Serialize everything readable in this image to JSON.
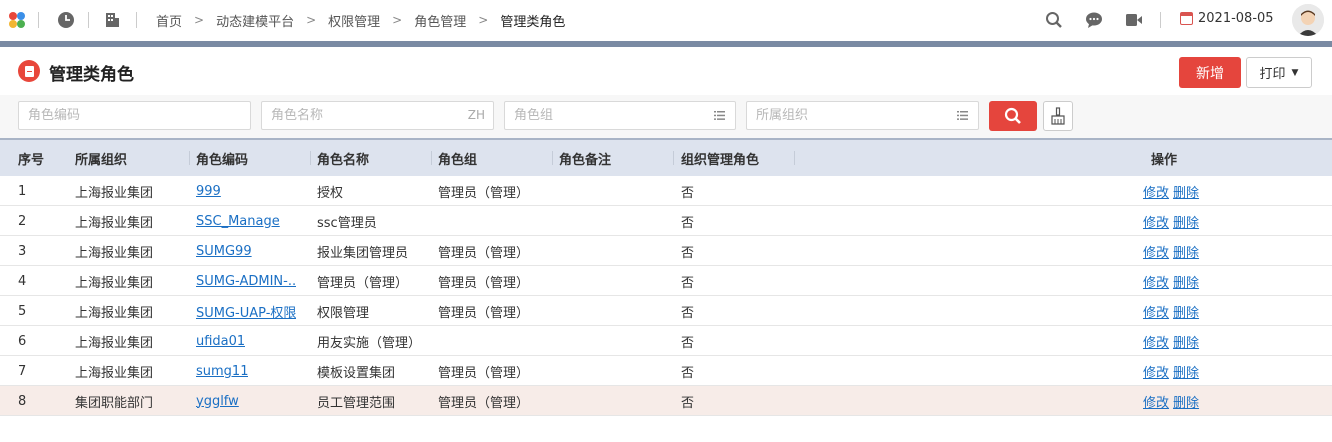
{
  "topbar": {
    "breadcrumbs": [
      "首页",
      "动态建模平台",
      "权限管理",
      "角色管理",
      "管理类角色"
    ],
    "date": "2021-08-05",
    "icons": [
      "app-logo-icon",
      "clock-icon",
      "building-icon",
      "search-icon",
      "chat-icon",
      "video-icon",
      "calendar-icon"
    ]
  },
  "page": {
    "title": "管理类角色",
    "new_label": "新增",
    "print_label": "打印"
  },
  "filters": {
    "code_placeholder": "角色编码",
    "name_placeholder": "角色名称",
    "name_suffix": "ZH",
    "group_placeholder": "角色组",
    "org_placeholder": "所属组织"
  },
  "table": {
    "headers": {
      "index": "序号",
      "org": "所属组织",
      "code": "角色编码",
      "name": "角色名称",
      "group": "角色组",
      "remark": "角色备注",
      "org_admin": "组织管理角色",
      "ops": "操作"
    },
    "edit_label": "修改",
    "delete_label": "删除",
    "rows": [
      {
        "index": "1",
        "org": "上海报业集团",
        "code": "999",
        "name": "授权",
        "group": "管理员（管理）",
        "remark": "",
        "org_admin": "否"
      },
      {
        "index": "2",
        "org": "上海报业集团",
        "code": "SSC_Manage",
        "name": "ssc管理员",
        "group": "",
        "remark": "",
        "org_admin": "否"
      },
      {
        "index": "3",
        "org": "上海报业集团",
        "code": "SUMG99",
        "name": "报业集团管理员",
        "group": "管理员（管理）",
        "remark": "",
        "org_admin": "否"
      },
      {
        "index": "4",
        "org": "上海报业集团",
        "code": "SUMG-ADMIN-...",
        "name": "管理员（管理）",
        "group": "管理员（管理）",
        "remark": "",
        "org_admin": "否"
      },
      {
        "index": "5",
        "org": "上海报业集团",
        "code": "SUMG-UAP-权限",
        "name": "权限管理",
        "group": "管理员（管理）",
        "remark": "",
        "org_admin": "否"
      },
      {
        "index": "6",
        "org": "上海报业集团",
        "code": "ufida01",
        "name": "用友实施（管理）",
        "group": "",
        "remark": "",
        "org_admin": "否"
      },
      {
        "index": "7",
        "org": "上海报业集团",
        "code": "sumg11",
        "name": "模板设置集团",
        "group": "管理员（管理）",
        "remark": "",
        "org_admin": "否"
      },
      {
        "index": "8",
        "org": "集团职能部门",
        "code": "ygglfw",
        "name": "员工管理范围",
        "group": "管理员（管理）",
        "remark": "",
        "org_admin": "否"
      }
    ]
  },
  "colors": {
    "accent": "#e5453d",
    "link": "#1a6fc4",
    "header_bg": "#dde3ee",
    "highlight_row": "#f7ece8"
  }
}
